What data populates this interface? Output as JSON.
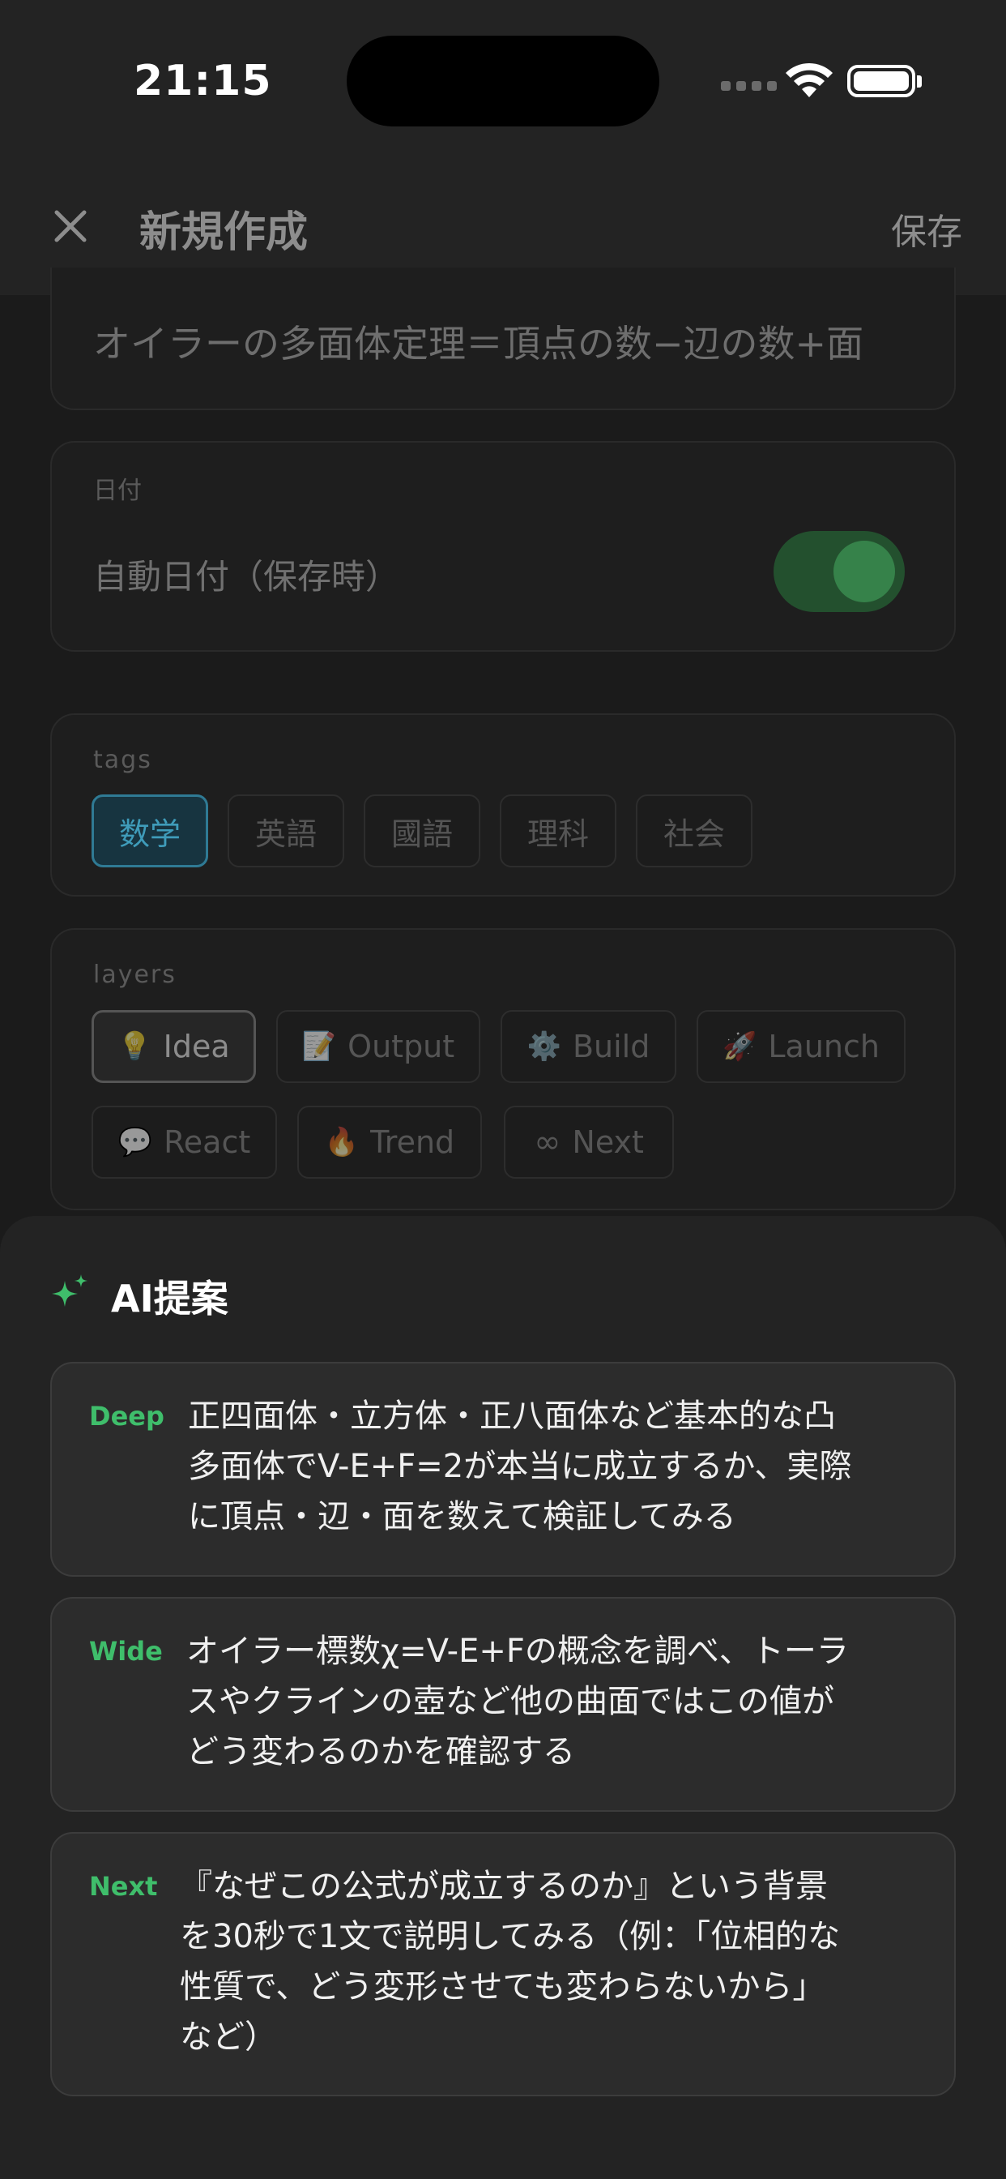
{
  "status_bar": {
    "time": "21:15"
  },
  "header": {
    "title": "新規作成",
    "save_label": "保存"
  },
  "title_field": {
    "value": "オイラーの多面体定理＝頂点の数−辺の数+面"
  },
  "date_section": {
    "label": "日付",
    "auto_date_label": "自動日付（保存時）",
    "auto_date_on": true
  },
  "tags_section": {
    "label": "tags",
    "items": [
      {
        "label": "数学",
        "selected": true
      },
      {
        "label": "英語",
        "selected": false
      },
      {
        "label": "國語",
        "selected": false
      },
      {
        "label": "理科",
        "selected": false
      },
      {
        "label": "社会",
        "selected": false
      }
    ]
  },
  "layers_section": {
    "label": "layers",
    "items": [
      {
        "emoji": "💡",
        "label": "Idea",
        "selected": true
      },
      {
        "emoji": "📝",
        "label": "Output",
        "selected": false
      },
      {
        "emoji": "⚙️",
        "label": "Build",
        "selected": false
      },
      {
        "emoji": "🚀",
        "label": "Launch",
        "selected": false
      },
      {
        "emoji": "💬",
        "label": "React",
        "selected": false
      },
      {
        "emoji": "🔥",
        "label": "Trend",
        "selected": false
      },
      {
        "emoji": "∞",
        "label": "Next",
        "selected": false
      }
    ]
  },
  "ai_panel": {
    "title": "AI提案",
    "suggestions": [
      {
        "kind": "Deep",
        "lines": [
          "正四面体・立方体・正八面体など基本的な凸",
          "多面体でV-E+F=2が本当に成立するか、実際",
          "に頂点・辺・面を数えて検証してみる"
        ]
      },
      {
        "kind": "Wide",
        "lines": [
          "オイラー標数χ=V-E+Fの概念を調べ、トーラ",
          "スやクラインの壺など他の曲面ではこの値が",
          "どう変わるのかを確認する"
        ]
      },
      {
        "kind": "Next",
        "lines": [
          "『なぜこの公式が成立するのか』という背景",
          "を30秒で1文で説明してみる（例：「位相的な",
          "性質で、どう変形させても変わらないから」",
          "など）"
        ]
      }
    ]
  },
  "colors": {
    "accent_green": "#3fbe6b",
    "tag_selected": "#3f9cba",
    "background": "#1b1b1b"
  }
}
